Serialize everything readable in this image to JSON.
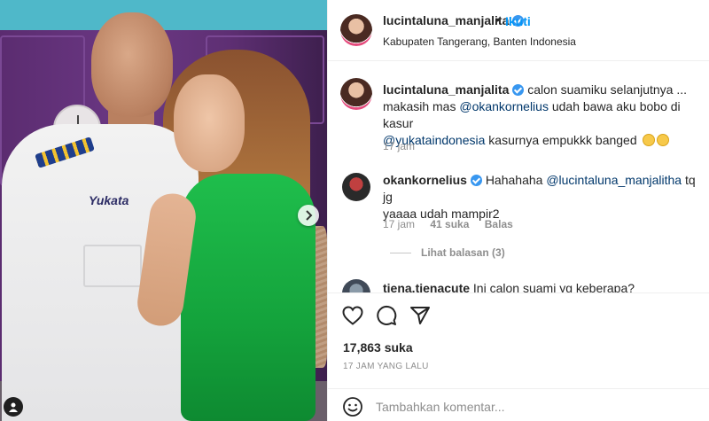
{
  "post": {
    "author": "lucintaluna_manjalita",
    "follow_label": "Ikuti",
    "follow_dot": "•",
    "location": "Kabupaten Tangerang, Banten Indonesia"
  },
  "photo": {
    "shirt_logo": "Yukata"
  },
  "caption": {
    "author": "lucintaluna_manjalita",
    "line1": "calon suamiku selanjutnya ...",
    "line2_a": "makasih mas ",
    "mention1": "@okankornelius",
    "line2_b": " udah bawa aku bobo di kasur",
    "mention2": "@yukataindonesia",
    "line3_b": " kasurnya empukkk banged",
    "time": "17 jam"
  },
  "comments": [
    {
      "author": "okankornelius",
      "text_a": "Hahahaha ",
      "mention": "@lucintaluna_manjalitha",
      "text_b": " tq jg",
      "text_c": "yaaaa udah mampir2",
      "time": "17 jam",
      "likes": "41 suka",
      "reply_label": "Balas",
      "view_replies": "Lihat balasan (3)"
    },
    {
      "author": "tiena.tienacute",
      "text": "Ini calon suami yg keberapa?"
    }
  ],
  "actions": {
    "like_count": "17,863 suka",
    "time_ago": "17 JAM YANG LALU"
  },
  "add_comment": {
    "placeholder": "Tambahkan komentar..."
  },
  "icons": {
    "like": "heart-icon",
    "comment": "comment-icon",
    "share": "send-icon",
    "emoji": "smiley-icon",
    "verified": "verified-badge-icon",
    "next": "chevron-right-icon",
    "tags": "person-tag-icon"
  },
  "colors": {
    "accent": "#0095f6",
    "mention": "#00376b",
    "verified": "#3897f0",
    "muted": "#8e8e8e"
  }
}
